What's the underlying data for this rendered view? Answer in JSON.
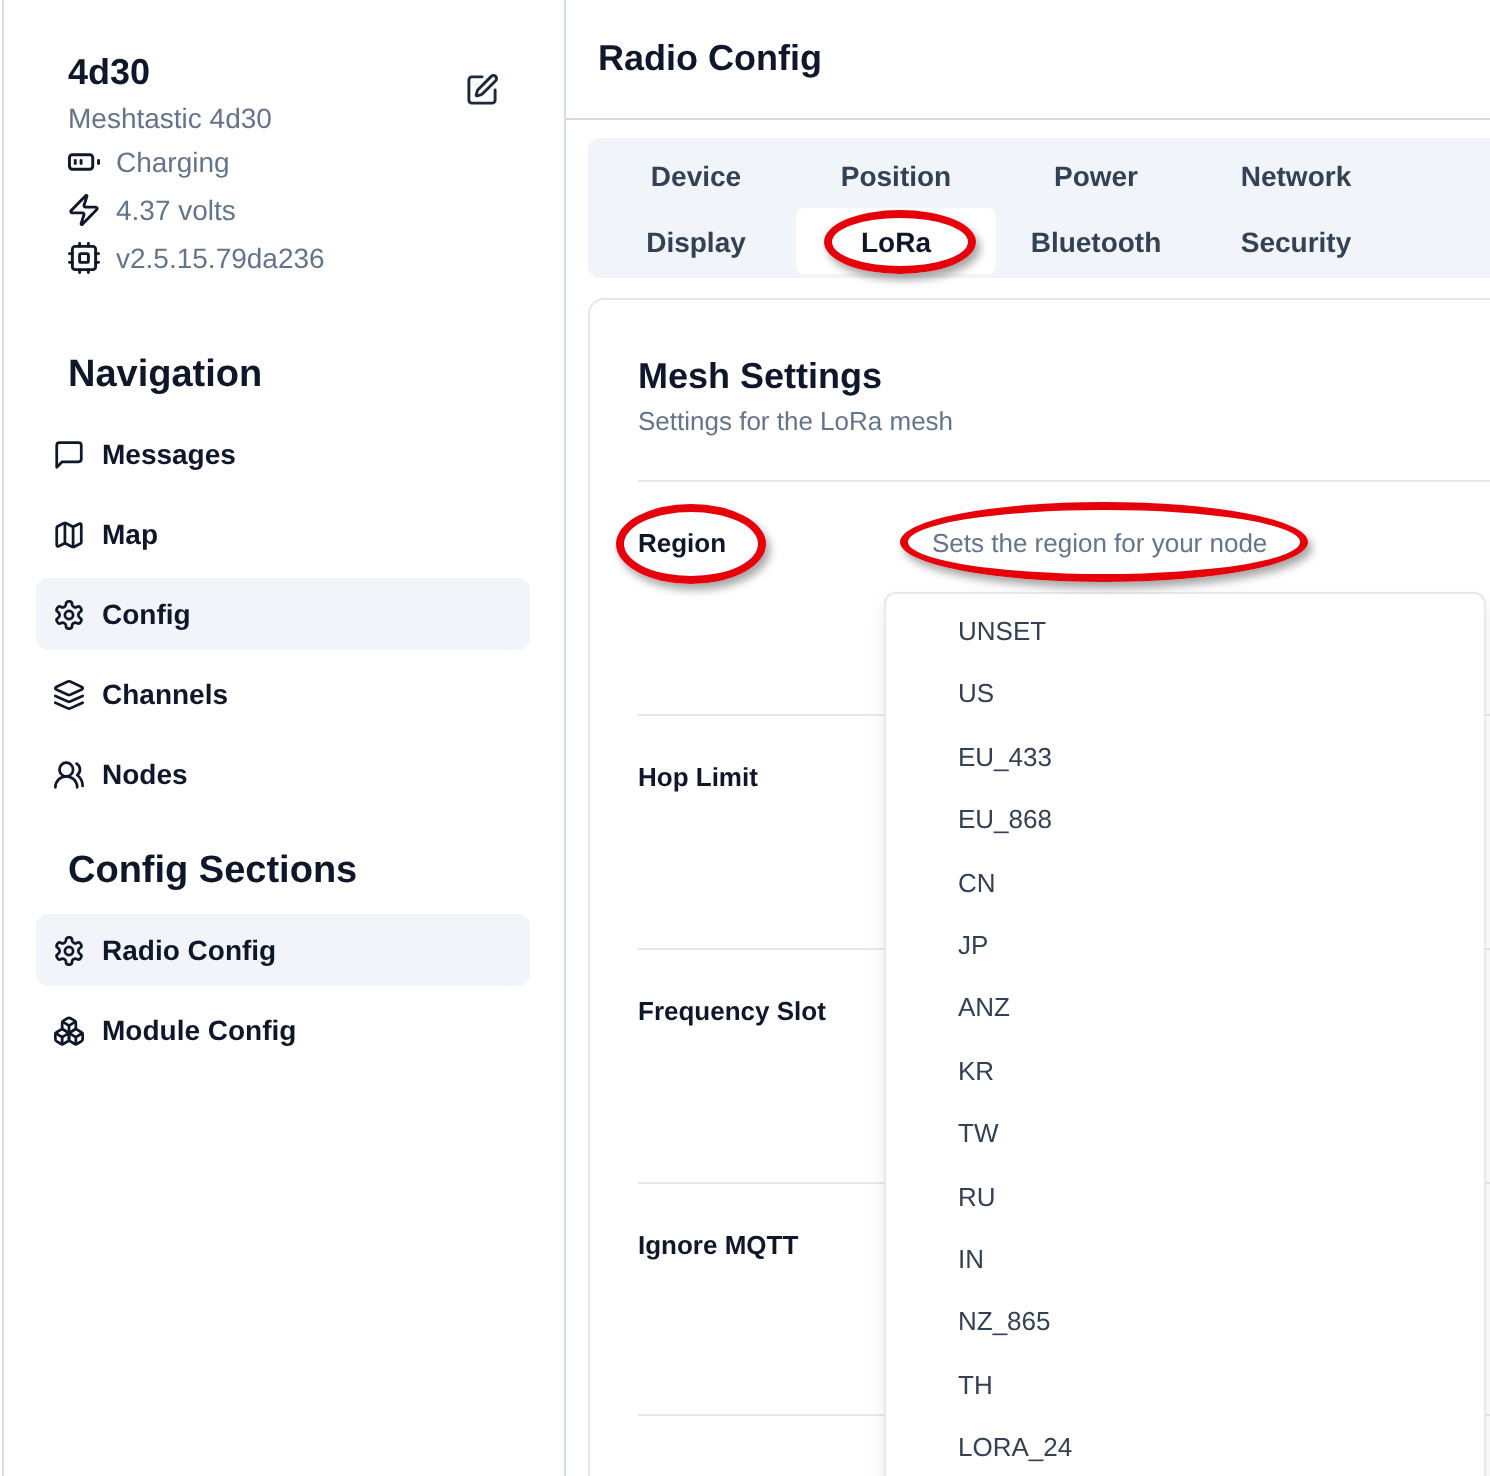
{
  "sidebar": {
    "device": {
      "name": "4d30",
      "model": "Meshtastic 4d30",
      "status": [
        "Charging",
        "4.37 volts",
        "v2.5.15.79da236"
      ]
    },
    "sections": [
      {
        "heading": "Navigation",
        "items": [
          {
            "label": "Messages",
            "selected": false
          },
          {
            "label": "Map",
            "selected": false
          },
          {
            "label": "Config",
            "selected": true
          },
          {
            "label": "Channels",
            "selected": false
          },
          {
            "label": "Nodes",
            "selected": false
          }
        ]
      },
      {
        "heading": "Config Sections",
        "items": [
          {
            "label": "Radio Config",
            "selected": true
          },
          {
            "label": "Module Config",
            "selected": false
          }
        ]
      }
    ]
  },
  "main": {
    "title": "Radio Config",
    "tabs": [
      {
        "label": "Device",
        "selected": false,
        "circled": false
      },
      {
        "label": "Position",
        "selected": false,
        "circled": false
      },
      {
        "label": "Power",
        "selected": false,
        "circled": false
      },
      {
        "label": "Network",
        "selected": false,
        "circled": false
      },
      {
        "label": "Display",
        "selected": false,
        "circled": false
      },
      {
        "label": "LoRa",
        "selected": true,
        "circled": true
      },
      {
        "label": "Bluetooth",
        "selected": false,
        "circled": false
      },
      {
        "label": "Security",
        "selected": false,
        "circled": false
      }
    ],
    "card": {
      "title": "Mesh Settings",
      "subtitle": "Settings for the LoRa mesh",
      "fields": [
        {
          "label": "Region",
          "label_circled": true,
          "description": "Sets the region for your node",
          "description_circled": true,
          "dropdown": {
            "options": [
              "UNSET",
              "US",
              "EU_433",
              "EU_868",
              "CN",
              "JP",
              "ANZ",
              "KR",
              "TW",
              "RU",
              "IN",
              "NZ_865",
              "TH",
              "LORA_24"
            ]
          }
        },
        {
          "label": "Hop Limit",
          "label_circled": false
        },
        {
          "label": "Frequency Slot",
          "label_circled": false
        },
        {
          "label": "Ignore MQTT",
          "label_circled": false
        }
      ]
    }
  }
}
